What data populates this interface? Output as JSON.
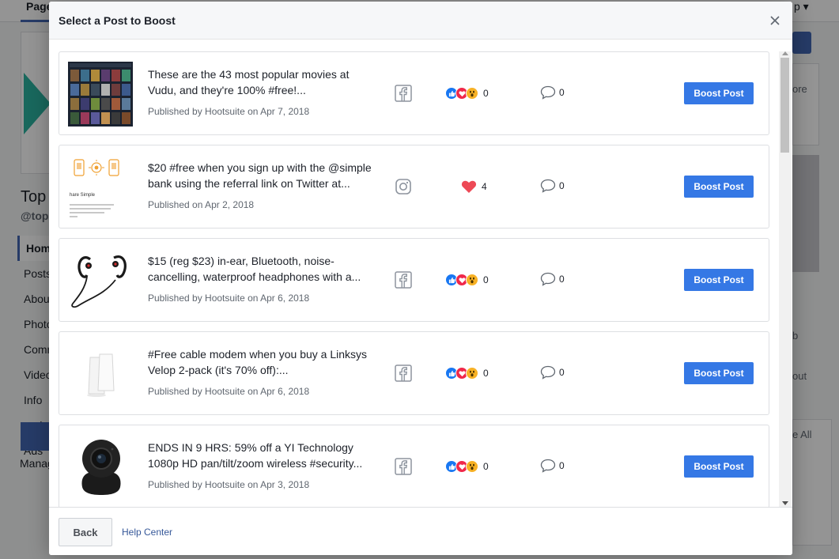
{
  "background": {
    "tab_label": "Page",
    "tab_right": "p ▾",
    "page_name": "Top",
    "page_handle": "@top",
    "nav": [
      "Home",
      "Posts",
      "About",
      "Photos",
      "Community",
      "Videos",
      "Info and Ads"
    ],
    "manage_label": "Manag",
    "right_texts": [
      "ore",
      "b",
      "out",
      "e All"
    ]
  },
  "dialog": {
    "title": "Select a Post to Boost",
    "posts": [
      {
        "thumb": "movies-grid",
        "line1": "These are the 43 most popular movies at",
        "line2": "Vudu, and they're 100% #free!...",
        "meta": "Published by Hootsuite on Apr 7, 2018",
        "network": "facebook",
        "reaction_type": "multi",
        "reaction_count": "0",
        "comment_count": "0",
        "button": "Boost Post"
      },
      {
        "thumb": "simple-bank",
        "line1": "$20 #free when you sign up with the @simple",
        "line2": "bank using the referral link on Twitter at...",
        "meta": "Published on Apr 2, 2018",
        "network": "instagram",
        "reaction_type": "heart",
        "reaction_count": "4",
        "comment_count": "0",
        "button": "Boost Post"
      },
      {
        "thumb": "headphones",
        "line1": "$15 (reg $23) in-ear, Bluetooth, noise-",
        "line2": "cancelling, waterproof headphones with a...",
        "meta": "Published by Hootsuite on Apr 6, 2018",
        "network": "facebook",
        "reaction_type": "multi",
        "reaction_count": "0",
        "comment_count": "0",
        "button": "Boost Post"
      },
      {
        "thumb": "modem",
        "line1": "#Free cable modem when you buy a Linksys",
        "line2": "Velop 2-pack (it's 70% off):...",
        "meta": "Published by Hootsuite on Apr 6, 2018",
        "network": "facebook",
        "reaction_type": "multi",
        "reaction_count": "0",
        "comment_count": "0",
        "button": "Boost Post"
      },
      {
        "thumb": "camera",
        "line1": "ENDS IN 9 HRS: 59% off a YI Technology",
        "line2": "1080p HD pan/tilt/zoom wireless #security...",
        "meta": "Published by Hootsuite on Apr 3, 2018",
        "network": "facebook",
        "reaction_type": "multi",
        "reaction_count": "0",
        "comment_count": "0",
        "button": "Boost Post"
      }
    ],
    "footer": {
      "back_label": "Back",
      "help_label": "Help Center"
    }
  },
  "colors": {
    "boost_button": "#3578e5",
    "like_blue": "#1877f2",
    "love_red": "#f0284a",
    "wow_yellow": "#f7b125",
    "link": "#365899"
  }
}
